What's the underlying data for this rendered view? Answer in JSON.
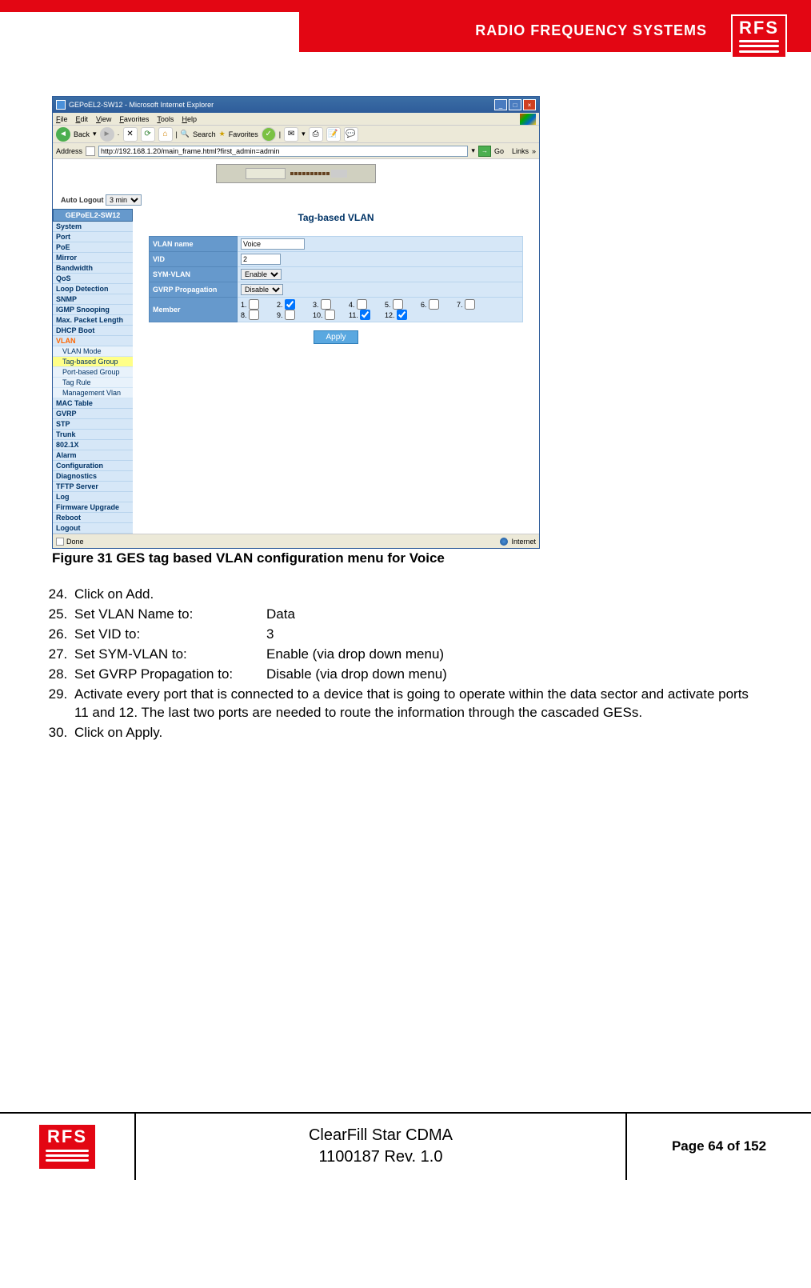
{
  "header": {
    "brand_text": "RADIO FREQUENCY SYSTEMS",
    "logo_text": "RFS"
  },
  "screenshot": {
    "window_title": "GEPoEL2-SW12 - Microsoft Internet Explorer",
    "menu": [
      "File",
      "Edit",
      "View",
      "Favorites",
      "Tools",
      "Help"
    ],
    "toolbar": {
      "back": "Back",
      "search": "Search",
      "favorites": "Favorites"
    },
    "address_label": "Address",
    "address_value": "http://192.168.1.20/main_frame.html?first_admin=admin",
    "go": "Go",
    "links": "Links",
    "auto_logout_label": "Auto Logout",
    "auto_logout_value": "3 min",
    "sidebar_header": "GEPoEL2-SW12",
    "sidebar": [
      "System",
      "Port",
      "PoE",
      "Mirror",
      "Bandwidth",
      "QoS",
      "Loop Detection",
      "SNMP",
      "IGMP Snooping",
      "Max. Packet Length",
      "DHCP Boot"
    ],
    "sidebar_vlan_hdr": "VLAN",
    "sidebar_vlan_sub": [
      "VLAN Mode",
      "Tag-based Group",
      "Port-based Group",
      "Tag Rule",
      "Management Vlan"
    ],
    "sidebar_after": [
      "MAC Table",
      "GVRP",
      "STP",
      "Trunk",
      "802.1X",
      "Alarm",
      "Configuration",
      "Diagnostics",
      "TFTP Server",
      "Log",
      "Firmware Upgrade",
      "Reboot",
      "Logout"
    ],
    "content_title": "Tag-based VLAN",
    "form": {
      "vlan_name_label": "VLAN name",
      "vlan_name_value": "Voice",
      "vid_label": "VID",
      "vid_value": "2",
      "sym_label": "SYM-VLAN",
      "sym_value": "Enable",
      "gvrp_label": "GVRP Propagation",
      "gvrp_value": "Disable",
      "member_label": "Member",
      "members": [
        {
          "n": "1.",
          "c": false
        },
        {
          "n": "2.",
          "c": true
        },
        {
          "n": "3.",
          "c": false
        },
        {
          "n": "4.",
          "c": false
        },
        {
          "n": "5.",
          "c": false
        },
        {
          "n": "6.",
          "c": false
        },
        {
          "n": "7.",
          "c": false
        },
        {
          "n": "8.",
          "c": false
        },
        {
          "n": "9.",
          "c": false
        },
        {
          "n": "10.",
          "c": false
        },
        {
          "n": "11.",
          "c": true
        },
        {
          "n": "12.",
          "c": true
        }
      ],
      "apply": "Apply"
    },
    "status_done": "Done",
    "status_internet": "Internet"
  },
  "figure_caption": "Figure 31 GES tag based VLAN configuration menu for Voice",
  "instructions": {
    "start": 24,
    "items": [
      {
        "text": "Click on Add."
      },
      {
        "label": "Set VLAN Name to:",
        "value": "Data"
      },
      {
        "label": "Set VID to:",
        "value": "3"
      },
      {
        "label": "Set SYM-VLAN to:",
        "value": "Enable (via drop down menu)"
      },
      {
        "label": "Set GVRP Propagation to:",
        "value": "Disable (via drop down menu)"
      },
      {
        "text": "Activate every port that is connected to a device that is going to operate within the data sector and activate ports 11 and 12. The last two ports are needed to route the information through the cascaded GESs."
      },
      {
        "text": "Click on Apply."
      }
    ]
  },
  "footer": {
    "logo_text": "RFS",
    "title_line1": "ClearFill Star CDMA",
    "title_line2": "1100187 Rev. 1.0",
    "page": "Page 64 of 152"
  }
}
